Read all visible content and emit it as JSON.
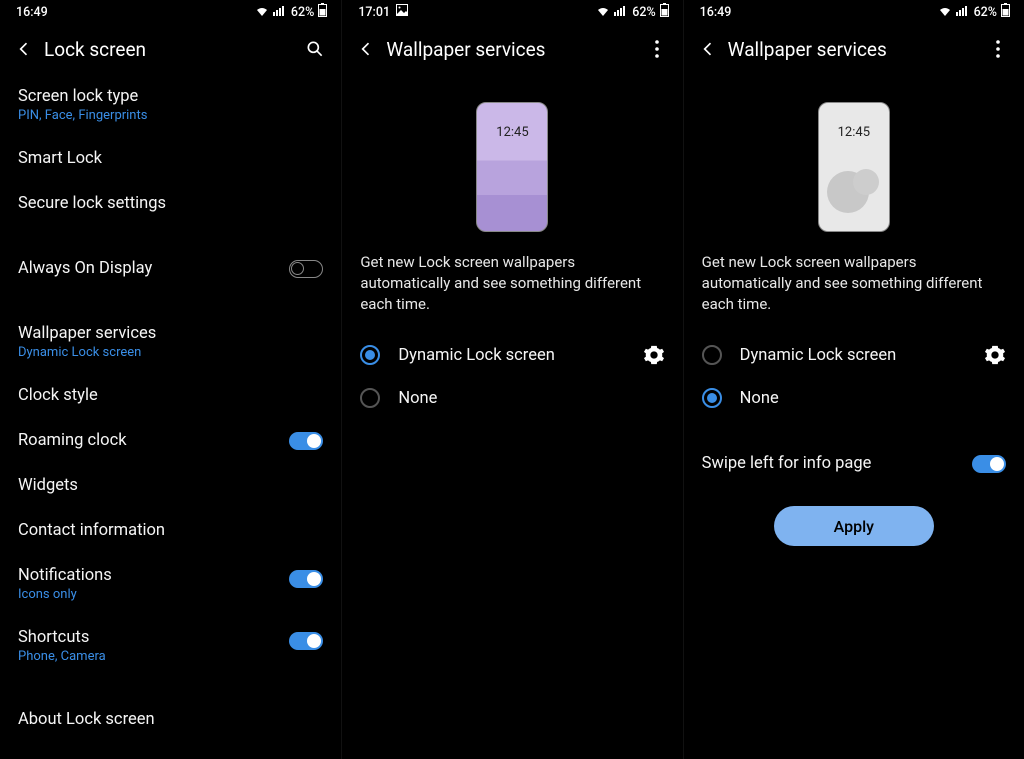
{
  "statusbar": {
    "battery_pct": "62%",
    "image_glyph": "🖼"
  },
  "pane1": {
    "status_time": "16:49",
    "header_title": "Lock screen",
    "items": [
      {
        "label": "Screen lock type",
        "sub": "PIN, Face, Fingerprints"
      },
      {
        "label": "Smart Lock"
      },
      {
        "label": "Secure lock settings"
      }
    ],
    "aod": {
      "label": "Always On Display"
    },
    "wallpaper": {
      "label": "Wallpaper services",
      "sub": "Dynamic Lock screen"
    },
    "clock_style": {
      "label": "Clock style"
    },
    "roaming": {
      "label": "Roaming clock"
    },
    "widgets": {
      "label": "Widgets"
    },
    "contact": {
      "label": "Contact information"
    },
    "notifications": {
      "label": "Notifications",
      "sub": "Icons only"
    },
    "shortcuts": {
      "label": "Shortcuts",
      "sub": "Phone, Camera"
    },
    "about": {
      "label": "About Lock screen"
    }
  },
  "pane2": {
    "status_time": "17:01",
    "header_title": "Wallpaper services",
    "preview_clock": "12:45",
    "desc": "Get new Lock screen wallpapers automatically and see something different each time.",
    "radio_dynamic": "Dynamic Lock screen",
    "radio_none": "None",
    "selected": "dynamic"
  },
  "pane3": {
    "status_time": "16:49",
    "header_title": "Wallpaper services",
    "preview_clock": "12:45",
    "desc": "Get new Lock screen wallpapers automatically and see something different each time.",
    "radio_dynamic": "Dynamic Lock screen",
    "radio_none": "None",
    "selected": "none",
    "swipe_label": "Swipe left for info page",
    "apply_label": "Apply"
  }
}
